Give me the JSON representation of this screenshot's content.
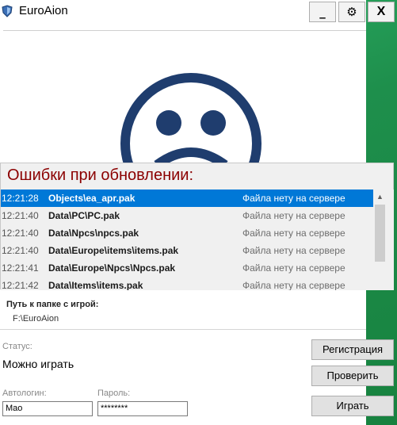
{
  "window": {
    "title": "EuroAion",
    "minimize_label": "_",
    "settings_label": "⚙",
    "close_label": "X"
  },
  "errors": {
    "heading": "Ошибки при обновлении:",
    "rows": [
      {
        "time": "12:21:28",
        "file": "Objects\\ea_apr.pak",
        "status": "Файла нету на сервере"
      },
      {
        "time": "12:21:40",
        "file": "Data\\PC\\PC.pak",
        "status": "Файла нету на сервере"
      },
      {
        "time": "12:21:40",
        "file": "Data\\Npcs\\npcs.pak",
        "status": "Файла нету на сервере"
      },
      {
        "time": "12:21:40",
        "file": "Data\\Europe\\items\\items.pak",
        "status": "Файла нету на сервере"
      },
      {
        "time": "12:21:41",
        "file": "Data\\Europe\\Npcs\\Npcs.pak",
        "status": "Файла нету на сервере"
      },
      {
        "time": "12:21:42",
        "file": "Data\\Items\\items.pak",
        "status": "Файла нету на сервере"
      }
    ]
  },
  "folder": {
    "label": "Путь к папке с игрой:",
    "value": "F:\\EuroAion"
  },
  "status": {
    "label": "Статус:",
    "value": "Можно играть"
  },
  "login": {
    "login_label": "Автологин:",
    "login_value": "Mao",
    "password_label": "Пароль:",
    "password_value": "********"
  },
  "buttons": {
    "register": "Регистрация",
    "check": "Проверить",
    "play": "Играть"
  },
  "colors": {
    "face": "#1f3d6e",
    "error_heading": "#8b0000",
    "selection": "#0078d7"
  }
}
